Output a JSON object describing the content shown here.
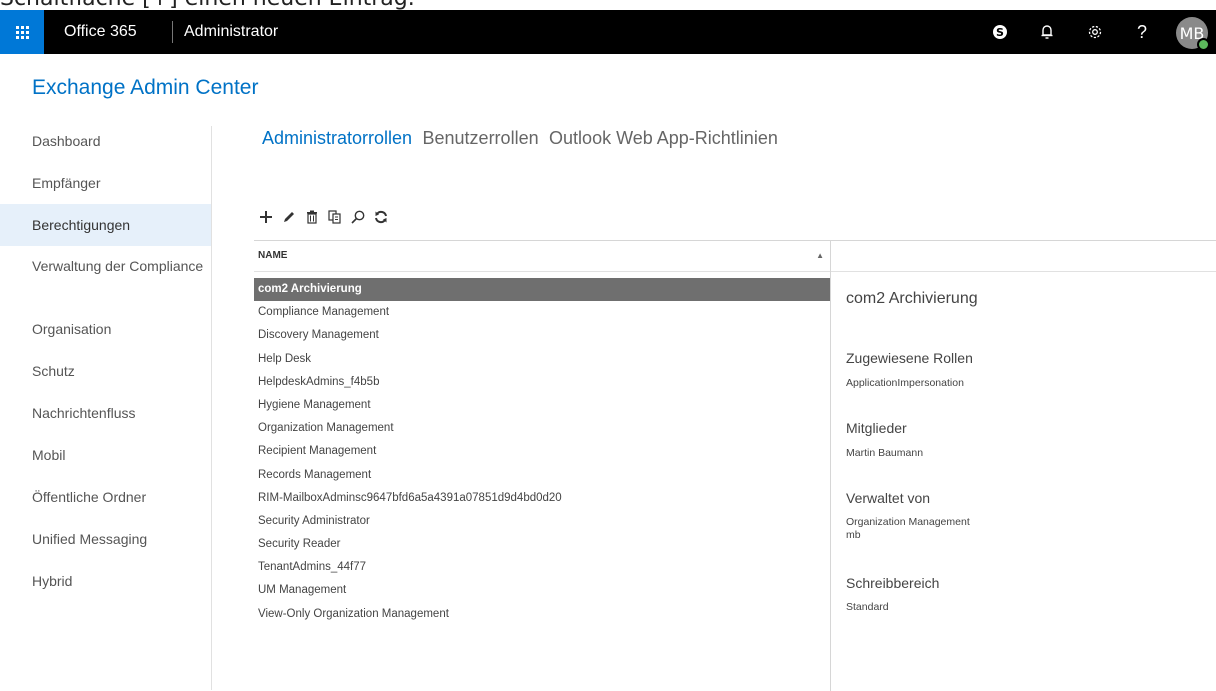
{
  "caption": "Schaltfläche [+] einen neuen Eintrag.",
  "topbar": {
    "brand": "Office 365",
    "section": "Administrator",
    "user_initials": "MB",
    "icons": [
      "waffle-icon",
      "skype-icon",
      "bell-icon",
      "gear-icon",
      "help-icon"
    ]
  },
  "app_title": "Exchange Admin Center",
  "nav": {
    "items": [
      {
        "label": "Dashboard"
      },
      {
        "label": "Empfänger"
      },
      {
        "label": "Berechtigungen",
        "active": true
      },
      {
        "label": "Verwaltung der Compliance"
      },
      {
        "label": "Organisation"
      },
      {
        "label": "Schutz"
      },
      {
        "label": "Nachrichtenfluss"
      },
      {
        "label": "Mobil"
      },
      {
        "label": "Öffentliche Ordner"
      },
      {
        "label": "Unified Messaging"
      },
      {
        "label": "Hybrid"
      }
    ]
  },
  "tabs": [
    {
      "label": "Administratorrollen",
      "active": true
    },
    {
      "label": "Benutzerrollen"
    },
    {
      "label": "Outlook Web App-Richtlinien"
    }
  ],
  "toolbar": {
    "icons": [
      "add-icon",
      "edit-icon",
      "delete-icon",
      "copy-icon",
      "search-icon",
      "refresh-icon"
    ]
  },
  "list": {
    "column_header": "NAME",
    "sort_indicator": "▲",
    "rows": [
      "com2 Archivierung",
      "Compliance Management",
      "Discovery Management",
      "Help Desk",
      "HelpdeskAdmins_f4b5b",
      "Hygiene Management",
      "Organization Management",
      "Recipient Management",
      "Records Management",
      "RIM-MailboxAdminsc9647bfd6a5a4391a07851d9d4bd0d20",
      "Security Administrator",
      "Security Reader",
      "TenantAdmins_44f77",
      "UM Management",
      "View-Only Organization Management"
    ],
    "selected_index": 0
  },
  "details": {
    "title": "com2 Archivierung",
    "assigned_roles_label": "Zugewiesene Rollen",
    "assigned_roles": "ApplicationImpersonation",
    "members_label": "Mitglieder",
    "members": "Martin Baumann",
    "managed_by_label": "Verwaltet von",
    "managed_by": [
      "Organization Management",
      "mb"
    ],
    "scope_label": "Schreibbereich",
    "scope": "Standard"
  },
  "colors": {
    "accent": "#0072c6",
    "topbar": "#000000",
    "waffle": "#0078d7",
    "selected_row": "#6f6f6f",
    "active_nav": "#e6f0fa"
  }
}
